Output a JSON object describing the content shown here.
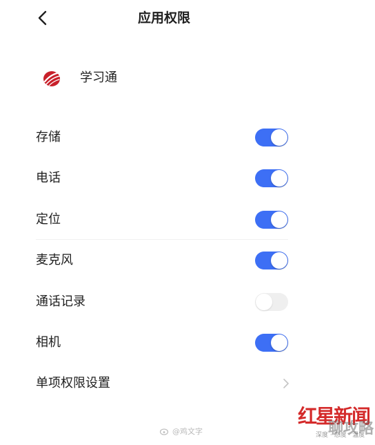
{
  "header": {
    "title": "应用权限",
    "back_icon": "chevron-left-icon"
  },
  "app": {
    "name": "学习通",
    "logo_icon": "xuexitong-logo-icon",
    "logo_color": "#c8202a"
  },
  "permissions": [
    {
      "label": "存储",
      "enabled": true
    },
    {
      "label": "电话",
      "enabled": true
    },
    {
      "label": "定位",
      "enabled": true
    },
    {
      "label": "麦克风",
      "enabled": true
    },
    {
      "label": "通话记录",
      "enabled": false
    },
    {
      "label": "相机",
      "enabled": true
    }
  ],
  "single_permission_setting": {
    "label": "单项权限设置",
    "icon": "chevron-right-icon"
  },
  "colors": {
    "toggle_on": "#3d6ff5",
    "toggle_off": "#efefef",
    "watermark_red": "#d42a2a"
  },
  "watermarks": {
    "weibo_text": "@鸡文字",
    "brand_text": "红星新闻",
    "brand_subtext": "深度 · 态度 · 温度",
    "overlay_text": "聊攻略"
  }
}
